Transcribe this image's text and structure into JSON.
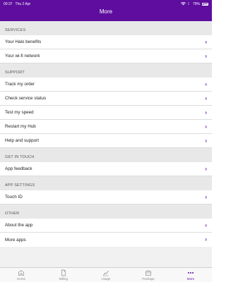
{
  "status_bar": {
    "time": "00:37",
    "date": "Thu 2 Apr",
    "battery": "79%"
  },
  "header": {
    "title": "More"
  },
  "sections": [
    {
      "title": "SERVICES",
      "items": [
        "Your Halo benefits",
        "Your wi-fi network"
      ]
    },
    {
      "title": "SUPPORT",
      "items": [
        "Track my order",
        "Check service status",
        "Test my speed",
        "Restart my Hub",
        "Help and support"
      ]
    },
    {
      "title": "GET IN TOUCH",
      "items": [
        "App feedback"
      ]
    },
    {
      "title": "APP SETTINGS",
      "items": [
        "Touch ID"
      ]
    },
    {
      "title": "OTHER",
      "items": [
        "About the app",
        "More apps"
      ]
    }
  ],
  "tabs": [
    {
      "label": "Home",
      "icon": "home-icon"
    },
    {
      "label": "Billing",
      "icon": "document-icon"
    },
    {
      "label": "Usage",
      "icon": "chart-icon"
    },
    {
      "label": "Package",
      "icon": "package-icon"
    },
    {
      "label": "More",
      "icon": "more-icon"
    }
  ],
  "colors": {
    "brand": "#5e0d9e",
    "section_bg": "#e8e8e8",
    "row_bg": "#ffffff"
  },
  "active_tab": "More"
}
